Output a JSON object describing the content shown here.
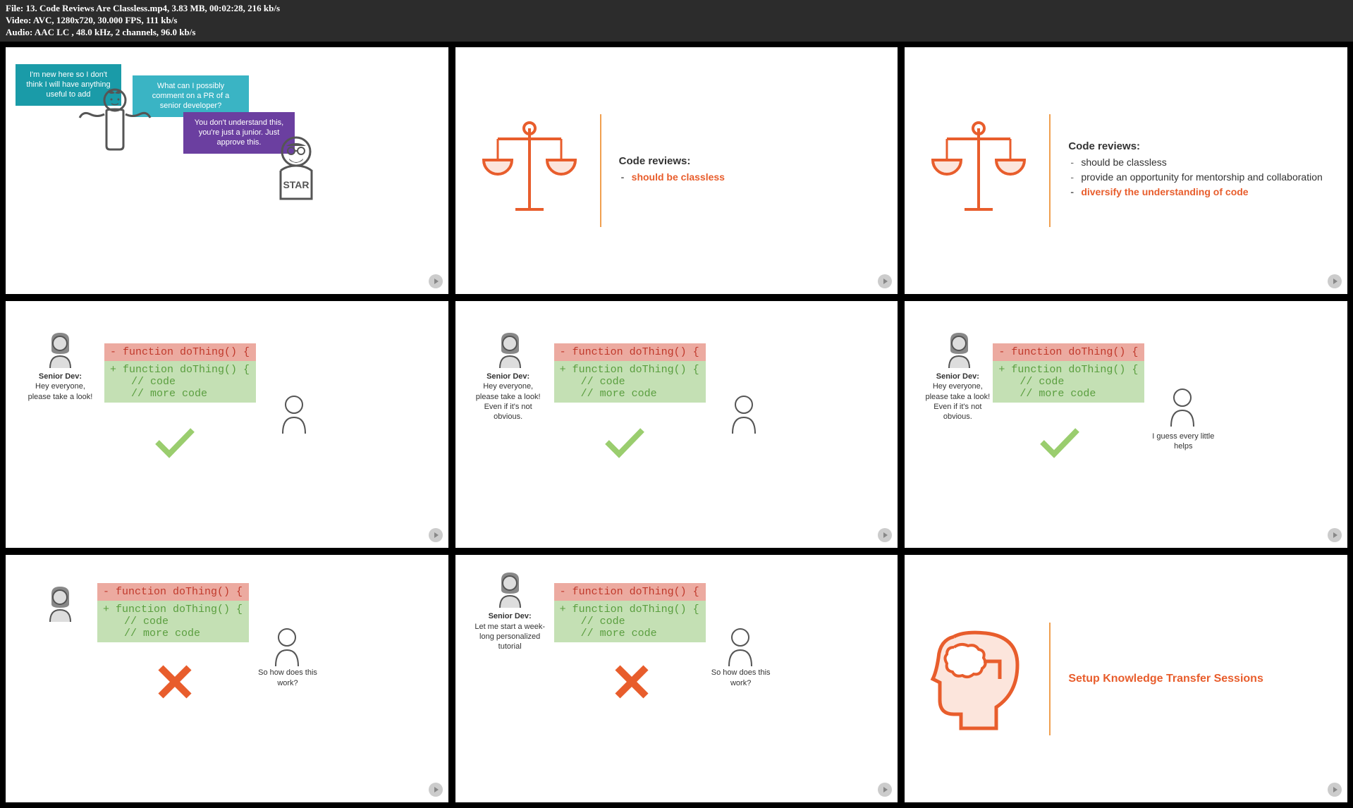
{
  "header": {
    "file_line": "File: 13. Code Reviews Are Classless.mp4, 3.83 MB, 00:02:28, 216 kb/s",
    "video_line": "Video: AVC, 1280x720, 30.000 FPS, 111 kb/s",
    "audio_line": "Audio: AAC LC , 48.0 kHz, 2 channels, 96.0 kb/s"
  },
  "slide1": {
    "bubble1": "I'm new here so I don't think I will have anything useful to add",
    "bubble2": "What can I possibly comment on a PR of a senior developer?",
    "bubble3": "You don't understand this, you're just a junior. Just approve this."
  },
  "slide2": {
    "title": "Code reviews:",
    "item1": "should be classless"
  },
  "slide3": {
    "title": "Code reviews:",
    "item1": "should be classless",
    "item2": "provide an opportunity for mentorship and collaboration",
    "item3": "diversify the understanding of code"
  },
  "code": {
    "line1": "- function doThing() {",
    "line2": "+ function doThing() {",
    "line3": "// code",
    "line4": "// more code"
  },
  "slide4": {
    "dev_label": "Senior Dev:",
    "dev_text": "Hey everyone, please take a look!"
  },
  "slide5": {
    "dev_label": "Senior Dev:",
    "dev_text": "Hey everyone, please take a look! Even if it's not obvious."
  },
  "slide6": {
    "dev_label": "Senior Dev:",
    "dev_text": "Hey everyone, please take a look! Even if it's not obvious.",
    "junior_text": "I guess every little helps"
  },
  "slide7": {
    "junior_text": "So how does this work?"
  },
  "slide8": {
    "dev_label": "Senior Dev:",
    "dev_text": "Let me start a week-long personalized tutorial",
    "junior_text": "So how does this work?"
  },
  "slide9": {
    "title": "Setup Knowledge Transfer Sessions"
  }
}
